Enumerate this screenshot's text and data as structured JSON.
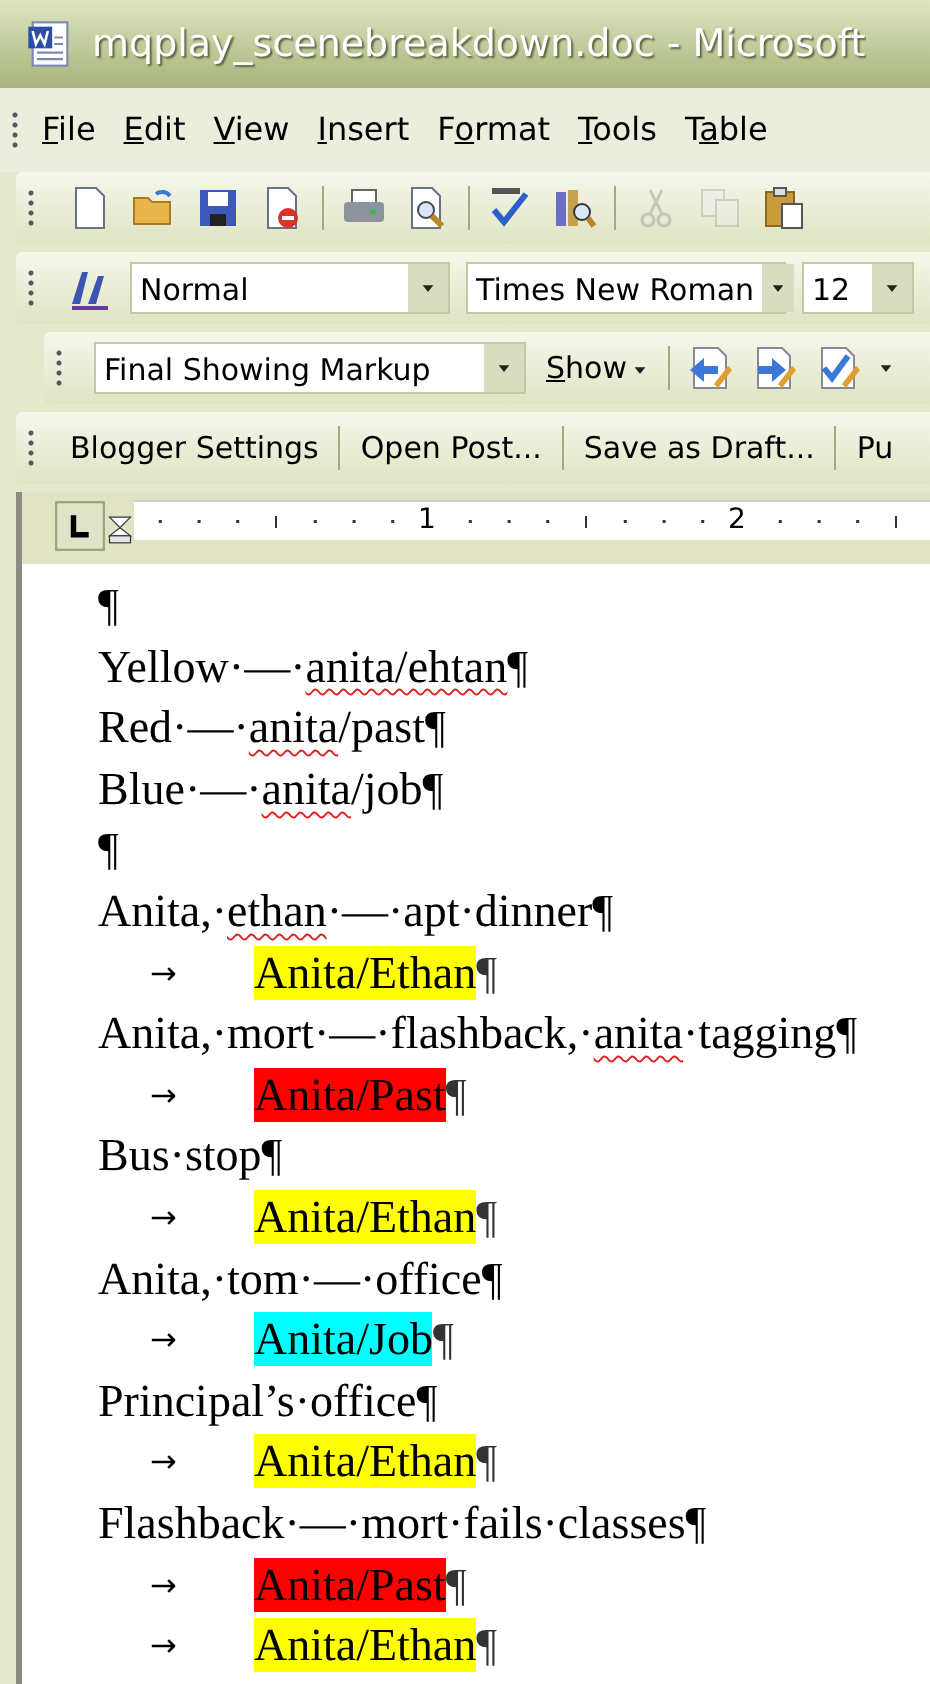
{
  "window": {
    "title": "mqplay_scenebreakdown.doc - Microsoft"
  },
  "menu": [
    {
      "parts": [
        {
          "text": "F",
          "underlined": true
        },
        {
          "text": "ile",
          "underlined": false
        }
      ]
    },
    {
      "parts": [
        {
          "text": "E",
          "underlined": true
        },
        {
          "text": "dit",
          "underlined": false
        }
      ]
    },
    {
      "parts": [
        {
          "text": "V",
          "underlined": true
        },
        {
          "text": "iew",
          "underlined": false
        }
      ]
    },
    {
      "parts": [
        {
          "text": "I",
          "underlined": true
        },
        {
          "text": "nsert",
          "underlined": false
        }
      ]
    },
    {
      "parts": [
        {
          "text": "F",
          "underlined": false
        },
        {
          "text": "o",
          "underlined": true
        },
        {
          "text": "rmat",
          "underlined": false
        }
      ]
    },
    {
      "parts": [
        {
          "text": "T",
          "underlined": true
        },
        {
          "text": "ools",
          "underlined": false
        }
      ]
    },
    {
      "parts": [
        {
          "text": "T",
          "underlined": false
        },
        {
          "text": "a",
          "underlined": true
        },
        {
          "text": "ble",
          "underlined": false
        }
      ]
    }
  ],
  "standard_toolbar": [
    {
      "kind": "new",
      "disabled": false
    },
    {
      "kind": "open",
      "disabled": false
    },
    {
      "kind": "save",
      "disabled": false
    },
    {
      "kind": "permission",
      "disabled": false
    },
    {
      "kind": "sep"
    },
    {
      "kind": "print",
      "disabled": false
    },
    {
      "kind": "preview",
      "disabled": false
    },
    {
      "kind": "sep"
    },
    {
      "kind": "spelling",
      "disabled": false
    },
    {
      "kind": "research",
      "disabled": false
    },
    {
      "kind": "sep"
    },
    {
      "kind": "cut",
      "disabled": true
    },
    {
      "kind": "copy",
      "disabled": true
    },
    {
      "kind": "paste",
      "disabled": false
    }
  ],
  "formatting_toolbar": {
    "style": "Normal",
    "font": "Times New Roman",
    "size": "12"
  },
  "reviewing_toolbar": {
    "display": "Final Showing Markup",
    "show": {
      "parts": [
        {
          "text": "S",
          "underlined": true
        },
        {
          "text": "how",
          "underlined": false
        }
      ]
    }
  },
  "blogger_toolbar": [
    "Blogger Settings",
    "Open Post...",
    "Save as Draft...",
    "Pu"
  ],
  "ruler": {
    "numbers": [
      "1",
      "2"
    ]
  },
  "document": [
    {
      "kind": "line",
      "parts": [
        {
          "text": "¶",
          "misspelled": false
        }
      ]
    },
    {
      "kind": "line",
      "parts": [
        {
          "text": "Yellow·—·",
          "misspelled": false
        },
        {
          "text": "anita/ehtan",
          "misspelled": true
        },
        {
          "text": "¶",
          "misspelled": false
        }
      ]
    },
    {
      "kind": "line",
      "parts": [
        {
          "text": "Red·—·",
          "misspelled": false
        },
        {
          "text": "anita",
          "misspelled": true
        },
        {
          "text": "/past¶",
          "misspelled": false
        }
      ]
    },
    {
      "kind": "line",
      "parts": [
        {
          "text": "Blue·—·",
          "misspelled": false
        },
        {
          "text": "anita",
          "misspelled": true
        },
        {
          "text": "/job¶",
          "misspelled": false
        }
      ]
    },
    {
      "kind": "line",
      "parts": [
        {
          "text": "¶",
          "misspelled": false
        }
      ]
    },
    {
      "kind": "line",
      "parts": [
        {
          "text": "Anita,·",
          "misspelled": false
        },
        {
          "text": "ethan",
          "misspelled": true
        },
        {
          "text": "·—·apt·dinner¶",
          "misspelled": false
        }
      ]
    },
    {
      "kind": "tag",
      "arrow": "→",
      "text": "Anita/Ethan",
      "color": "#ffff00",
      "mark": "¶"
    },
    {
      "kind": "line",
      "parts": [
        {
          "text": "Anita,·mort·—·flashback,·",
          "misspelled": false
        },
        {
          "text": "anita",
          "misspelled": true
        },
        {
          "text": "·tagging¶",
          "misspelled": false
        }
      ]
    },
    {
      "kind": "tag",
      "arrow": "→",
      "text": "Anita/Past",
      "color": "#ff0000",
      "mark": "¶"
    },
    {
      "kind": "line",
      "parts": [
        {
          "text": "Bus·stop¶",
          "misspelled": false
        }
      ]
    },
    {
      "kind": "tag",
      "arrow": "→",
      "text": "Anita/Ethan",
      "color": "#ffff00",
      "mark": "¶"
    },
    {
      "kind": "line",
      "parts": [
        {
          "text": "Anita,·tom·—·office¶",
          "misspelled": false
        }
      ]
    },
    {
      "kind": "tag",
      "arrow": "→",
      "text": "Anita/Job",
      "color": "#00ffff",
      "mark": "¶"
    },
    {
      "kind": "line",
      "parts": [
        {
          "text": "Principal’s·office¶",
          "misspelled": false
        }
      ]
    },
    {
      "kind": "tag",
      "arrow": "→",
      "text": "Anita/Ethan",
      "color": "#ffff00",
      "mark": "¶"
    },
    {
      "kind": "line",
      "parts": [
        {
          "text": "Flashback·—·mort·fails·classes¶",
          "misspelled": false
        }
      ]
    },
    {
      "kind": "tag",
      "arrow": "→",
      "text": "Anita/Past",
      "color": "#ff0000",
      "mark": "¶"
    },
    {
      "kind": "tag",
      "arrow": "→",
      "text": "Anita/Ethan",
      "color": "#ffff00",
      "mark": "¶"
    }
  ]
}
